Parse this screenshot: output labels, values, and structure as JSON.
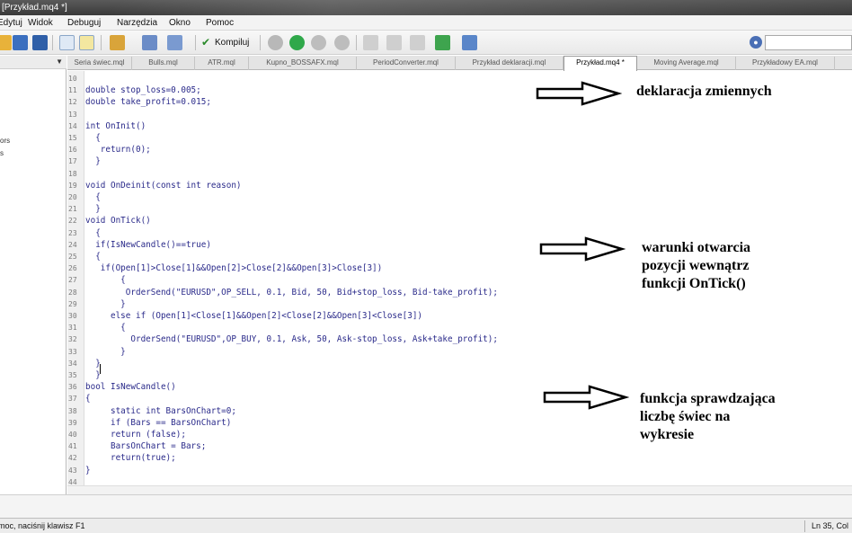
{
  "window": {
    "title": "[Przykład.mq4 *]"
  },
  "menu": [
    "Edytuj",
    "Widok",
    "Debuguj",
    "Narzędzia",
    "Okno",
    "Pomoc"
  ],
  "toolbar": {
    "compile_label": "Kompiluj"
  },
  "tabs": [
    {
      "label": "Seria świec.mql",
      "active": false
    },
    {
      "label": "Bulls.mql",
      "active": false
    },
    {
      "label": "ATR.mql",
      "active": false
    },
    {
      "label": "Kupno_BOSSAFX.mql",
      "active": false
    },
    {
      "label": "PeriodConverter.mql",
      "active": false
    },
    {
      "label": "Przykład deklaracji.mql",
      "active": false
    },
    {
      "label": "Przykład.mq4 *",
      "active": true
    },
    {
      "label": "Moving Average.mql",
      "active": false
    },
    {
      "label": "Przykładowy EA.mql",
      "active": false
    }
  ],
  "left_panel_fragments": [
    "ors",
    "s"
  ],
  "code_lines": [
    {
      "n": "10",
      "text": ""
    },
    {
      "n": "11",
      "text": "double stop_loss=0.005;"
    },
    {
      "n": "12",
      "text": "double take_profit=0.015;"
    },
    {
      "n": "13",
      "text": ""
    },
    {
      "n": "14",
      "text": "int OnInit()"
    },
    {
      "n": "15",
      "text": "  {"
    },
    {
      "n": "16",
      "text": "   return(0);"
    },
    {
      "n": "17",
      "text": "  }"
    },
    {
      "n": "18",
      "text": ""
    },
    {
      "n": "19",
      "text": "void OnDeinit(const int reason)"
    },
    {
      "n": "20",
      "text": "  {"
    },
    {
      "n": "21",
      "text": "  }"
    },
    {
      "n": "22",
      "text": "void OnTick()"
    },
    {
      "n": "23",
      "text": "  {"
    },
    {
      "n": "24",
      "text": "  if(IsNewCandle()==true)"
    },
    {
      "n": "25",
      "text": "  {"
    },
    {
      "n": "26",
      "text": "   if(Open[1]>Close[1]&&Open[2]>Close[2]&&Open[3]>Close[3])"
    },
    {
      "n": "27",
      "text": "       {"
    },
    {
      "n": "28",
      "text": "        OrderSend(\"EURUSD\",OP_SELL, 0.1, Bid, 50, Bid+stop_loss, Bid-take_profit);"
    },
    {
      "n": "29",
      "text": "       }"
    },
    {
      "n": "30",
      "text": "     else if (Open[1]<Close[1]&&Open[2]<Close[2]&&Open[3]<Close[3])"
    },
    {
      "n": "31",
      "text": "       {"
    },
    {
      "n": "32",
      "text": "         OrderSend(\"EURUSD\",OP_BUY, 0.1, Ask, 50, Ask-stop_loss, Ask+take_profit);"
    },
    {
      "n": "33",
      "text": "       }"
    },
    {
      "n": "34",
      "text": "  }"
    },
    {
      "n": "35",
      "text": "  }"
    },
    {
      "n": "36",
      "text": "bool IsNewCandle()"
    },
    {
      "n": "37",
      "text": "{"
    },
    {
      "n": "38",
      "text": "     static int BarsOnChart=0;"
    },
    {
      "n": "39",
      "text": "     if (Bars == BarsOnChart)"
    },
    {
      "n": "40",
      "text": "     return (false);"
    },
    {
      "n": "41",
      "text": "     BarsOnChart = Bars;"
    },
    {
      "n": "42",
      "text": "     return(true);"
    },
    {
      "n": "43",
      "text": "}"
    },
    {
      "n": "44",
      "text": ""
    }
  ],
  "annotations": [
    {
      "text": "deklaracja zmiennych"
    },
    {
      "text": "warunki otwarcia\npozycji wewnątrz\nfunkcji OnTick()"
    },
    {
      "text": "funkcja sprawdzająca\nliczbę świec na\nwykresie"
    }
  ],
  "status": {
    "help": "moc, naciśnij klawisz F1",
    "position": "Ln 35, Col"
  }
}
